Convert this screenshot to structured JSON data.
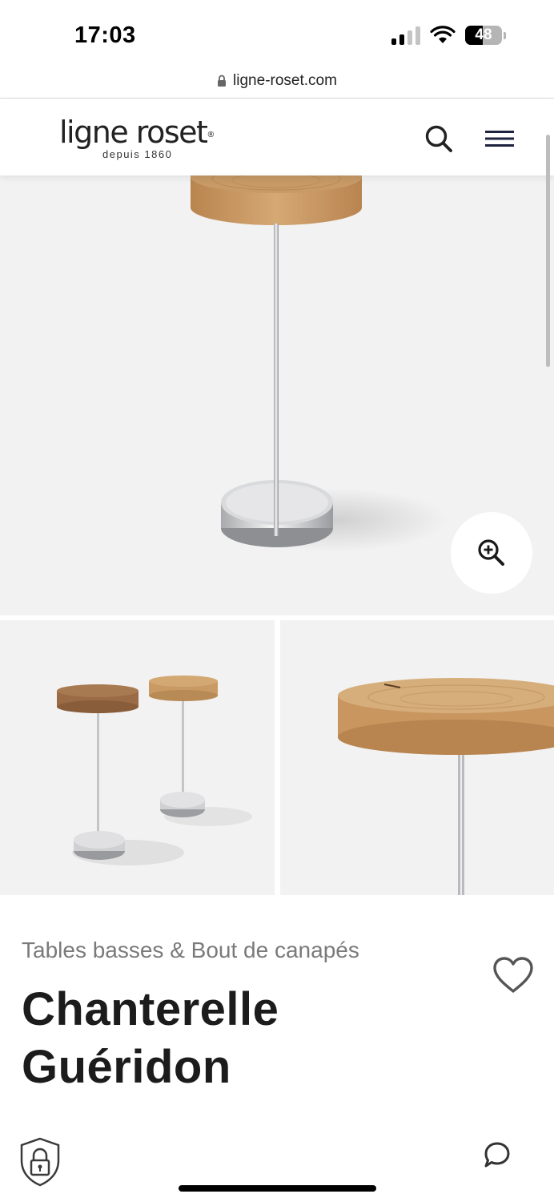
{
  "status_bar": {
    "time": "17:03",
    "battery_level": "48"
  },
  "url_bar": {
    "url": "ligne-roset.com",
    "icon": "lock-icon"
  },
  "header": {
    "logo_text": "ligne roset",
    "logo_mark": "®",
    "logo_tagline": "depuis 1860",
    "search_icon": "search-icon",
    "menu_icon": "hamburger-menu-icon"
  },
  "hero": {
    "zoom_icon": "zoom-in-icon"
  },
  "product": {
    "category": "Tables basses & Bout de canapés",
    "title_line1": "Chanterelle",
    "title_line2": "Guéridon",
    "favorite_icon": "heart-icon"
  },
  "footer": {
    "privacy_icon": "shield-lock-icon",
    "chat_icon": "chat-bubble-icon"
  },
  "colors": {
    "image_bg": "#f2f2f2",
    "category_text": "#7a7a7a",
    "title_text": "#1c1c1c",
    "wood": "#c99a63"
  }
}
